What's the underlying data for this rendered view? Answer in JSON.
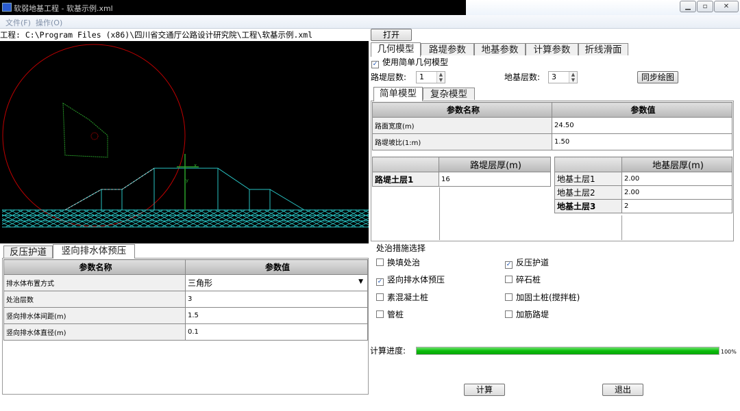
{
  "window": {
    "title": "软弱地基工程 - 软基示例.xml"
  },
  "menu": {
    "file": "文件(F)",
    "operate": "操作(O)"
  },
  "project_path": {
    "label": "工程:",
    "value": "C:\\Program Files (x86)\\四川省交通厅公路设计研究院\\工程\\软基示例.xml",
    "open_button": "打开"
  },
  "main_tabs": [
    "几何模型",
    "路堤参数",
    "地基参数",
    "计算参数",
    "折线滑面"
  ],
  "geometry": {
    "use_simple_label": "使用简单几何模型",
    "use_simple_checked": true,
    "embank_layers_label": "路堤层数:",
    "embank_layers_value": "1",
    "foundation_layers_label": "地基层数:",
    "foundation_layers_value": "3",
    "sync_button": "同步绘图"
  },
  "sub_tabs": [
    "简单模型",
    "复杂模型"
  ],
  "simple_params": {
    "header_name": "参数名称",
    "header_value": "参数值",
    "rows": [
      {
        "name": "路面宽度(m)",
        "value": "24.50"
      },
      {
        "name": "路堤坡比(1:m)",
        "value": "1.50"
      }
    ]
  },
  "embank_layers": {
    "header": "路堤层厚(m)",
    "rows": [
      {
        "name": "路堤土层1",
        "value": "16"
      }
    ]
  },
  "foundation_layers": {
    "header": "地基层厚(m)",
    "rows": [
      {
        "name": "地基土层1",
        "value": "2.00"
      },
      {
        "name": "地基土层2",
        "value": "2.00"
      },
      {
        "name": "地基土层3",
        "value": "2"
      }
    ]
  },
  "bottom_tabs": [
    "反压护道",
    "竖向排水体预压"
  ],
  "drain_params": {
    "header_name": "参数名称",
    "header_value": "参数值",
    "rows": [
      {
        "name": "排水体布置方式",
        "value": "三角形"
      },
      {
        "name": "处治层数",
        "value": "3"
      },
      {
        "name": "竖向排水体间距(m)",
        "value": "1.5"
      },
      {
        "name": "竖向排水体直径(m)",
        "value": "0.1"
      }
    ]
  },
  "measures": {
    "title": "处治措施选择",
    "items": [
      {
        "label": "换填处治",
        "checked": false
      },
      {
        "label": "反压护道",
        "checked": true
      },
      {
        "label": "竖向排水体预压",
        "checked": true
      },
      {
        "label": "碎石桩",
        "checked": false
      },
      {
        "label": "素混凝土桩",
        "checked": false
      },
      {
        "label": "加固土桩(搅拌桩)",
        "checked": false
      },
      {
        "label": "管桩",
        "checked": false
      },
      {
        "label": "加筋路堤",
        "checked": false
      }
    ]
  },
  "progress": {
    "label": "计算进度:",
    "percent": 100,
    "percent_text": "100%"
  },
  "buttons": {
    "compute": "计算",
    "exit": "退出"
  },
  "canvas_axis": {
    "x": "x",
    "y": "y"
  },
  "colors": {
    "canvas_bg": "#000000",
    "circle": "#c00000",
    "slice": "#2aa02a",
    "embankment": "#29c4c4",
    "progress": "#0bbd0b"
  }
}
